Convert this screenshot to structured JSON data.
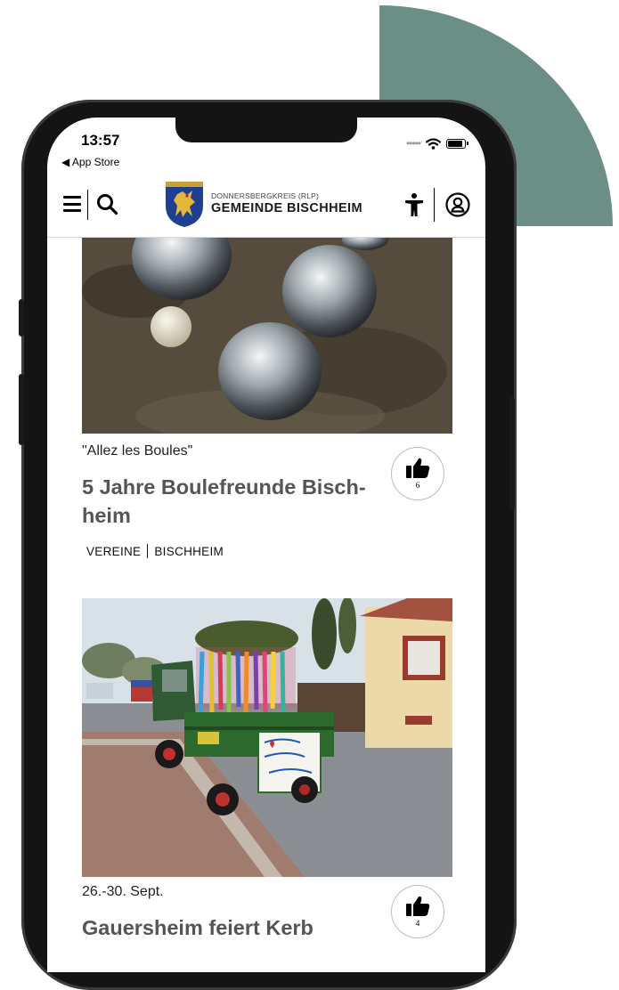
{
  "status": {
    "time": "13:57",
    "back_label": "◀ App Store"
  },
  "header": {
    "brand_sup": "DONNERSBERGKREIS (RLP)",
    "brand_name": "GEMEINDE BISCHHEIM"
  },
  "colors": {
    "accent": "#6b8f87",
    "phone": "#141414",
    "title_gray": "#555555"
  },
  "articles": [
    {
      "kicker": "\"Allez les Boules\"",
      "title": "5 Jahre Boulefreunde Bisch-heim",
      "tags": [
        "VEREINE",
        "BISCHHEIM"
      ],
      "likes": "6"
    },
    {
      "kicker": "26.-30. Sept.",
      "title": "Gauersheim feiert Kerb",
      "likes": "4"
    }
  ]
}
